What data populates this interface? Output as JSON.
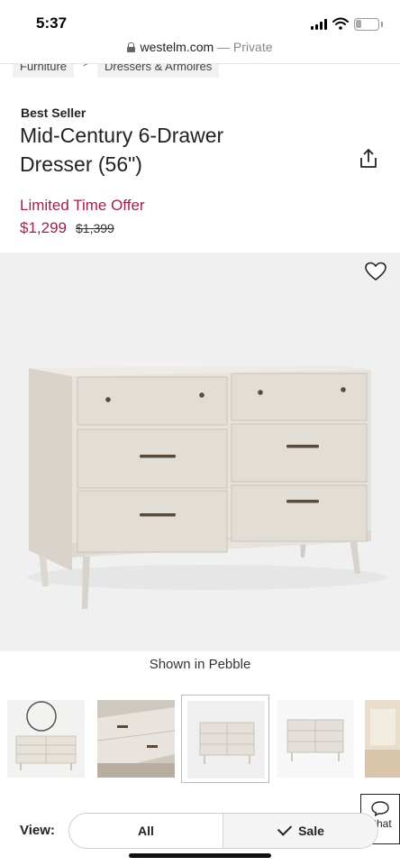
{
  "status_bar": {
    "time": "5:37",
    "battery_level": "7"
  },
  "url_bar": {
    "domain": "westelm.com",
    "suffix": "— Private"
  },
  "breadcrumb": {
    "items": [
      "Furniture",
      "Dressers & Armoires"
    ],
    "separator": ">"
  },
  "product": {
    "badge": "Best Seller",
    "title": "Mid-Century 6-Drawer Dresser (56\")",
    "offer_label": "Limited Time Offer",
    "price": "$1,299",
    "original_price": "$1,399"
  },
  "hero": {
    "caption": "Shown in Pebble"
  },
  "view_filter": {
    "label": "View:",
    "options": [
      "All",
      "Sale"
    ],
    "selected": "Sale"
  },
  "chat": {
    "label": "Chat"
  },
  "colors": {
    "accent": "#9c2345",
    "dresser_finish": "#e7e3dc"
  }
}
